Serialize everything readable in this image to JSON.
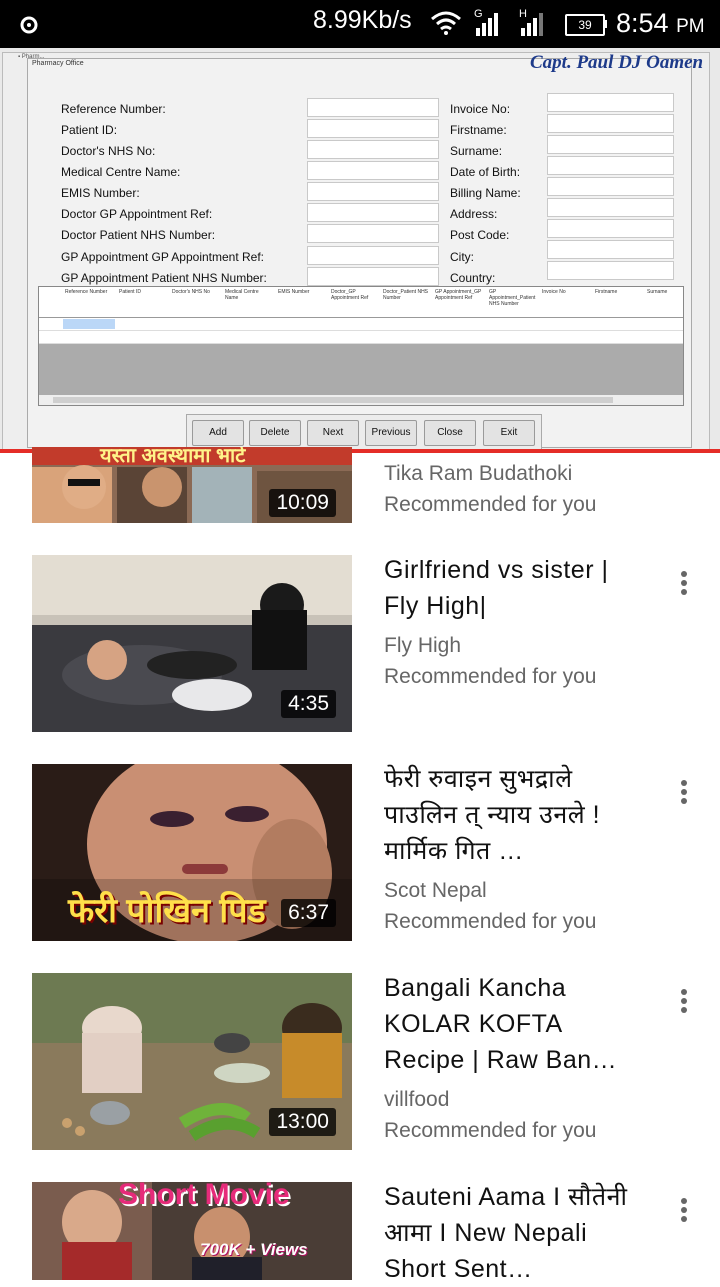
{
  "status_bar": {
    "speed": "8.99Kb/s",
    "battery": "39",
    "time": "8:54",
    "ampm": "PM",
    "signal1_label": "G",
    "signal2_label": "H"
  },
  "player": {
    "caption": "Capt. Paul DJ Oamen",
    "window_title": "Pharmacy Office",
    "form": {
      "left_labels": [
        "Reference Number:",
        "Patient  ID:",
        "Doctor's NHS No:",
        "Medical Centre Name:",
        "EMIS Number:",
        "Doctor GP Appointment Ref:",
        "Doctor Patient NHS Number:",
        "GP Appointment GP Appointment Ref:",
        "GP Appointment Patient NHS Number:"
      ],
      "right_labels": [
        "Invoice No:",
        "Firstname:",
        "Surname:",
        "Date of Birth:",
        "Billing Name:",
        "Address:",
        "Post Code:",
        "City:",
        "Country:"
      ]
    },
    "grid_columns": [
      "Reference Number",
      "Patient ID",
      "Doctor's NHS No",
      "Medical Centre Name",
      "EMIS Number",
      "Doctor_GP Appointment Ref",
      "Doctor_Patient NHS Number",
      "GP Appointment_GP Appointment Ref",
      "GP Appointment_Patient NHS Number",
      "Invoice No",
      "Firstname",
      "Surname"
    ],
    "buttons": [
      "Add",
      "Delete",
      "Next",
      "Previous",
      "Close",
      "Exit"
    ]
  },
  "feed": [
    {
      "title": "",
      "channel": "Tika Ram Budathoki",
      "recommended": "Recommended for you",
      "duration": "10:09",
      "overlay_text": "यस्ता अवस्थामा भाटे"
    },
    {
      "title": "Girlfriend vs sister | Fly High|",
      "channel": "Fly High",
      "recommended": "Recommended for you",
      "duration": "4:35"
    },
    {
      "title": "फेरी रुवाइन सुभद्राले पाउलिन त् न्याय उनले ! मार्मिक गित …",
      "channel": "Scot Nepal",
      "recommended": "Recommended for you",
      "duration": "6:37",
      "overlay_text": "फेरी पोखिन पिड"
    },
    {
      "title": "Bangali Kancha KOLAR KOFTA Recipe | Raw Ban…",
      "channel": "villfood",
      "recommended": "Recommended for you",
      "duration": "13:00"
    },
    {
      "title": "Sauteni Aama  I  सौतेनी आमा I  New Nepali Short Sent…",
      "channel": "",
      "recommended": "",
      "duration": "",
      "overlay_text": "Short Movie",
      "overlay_text2": "700K + Views"
    }
  ],
  "colors": {
    "accent": "#e52d27",
    "secondary_text": "#666666"
  }
}
